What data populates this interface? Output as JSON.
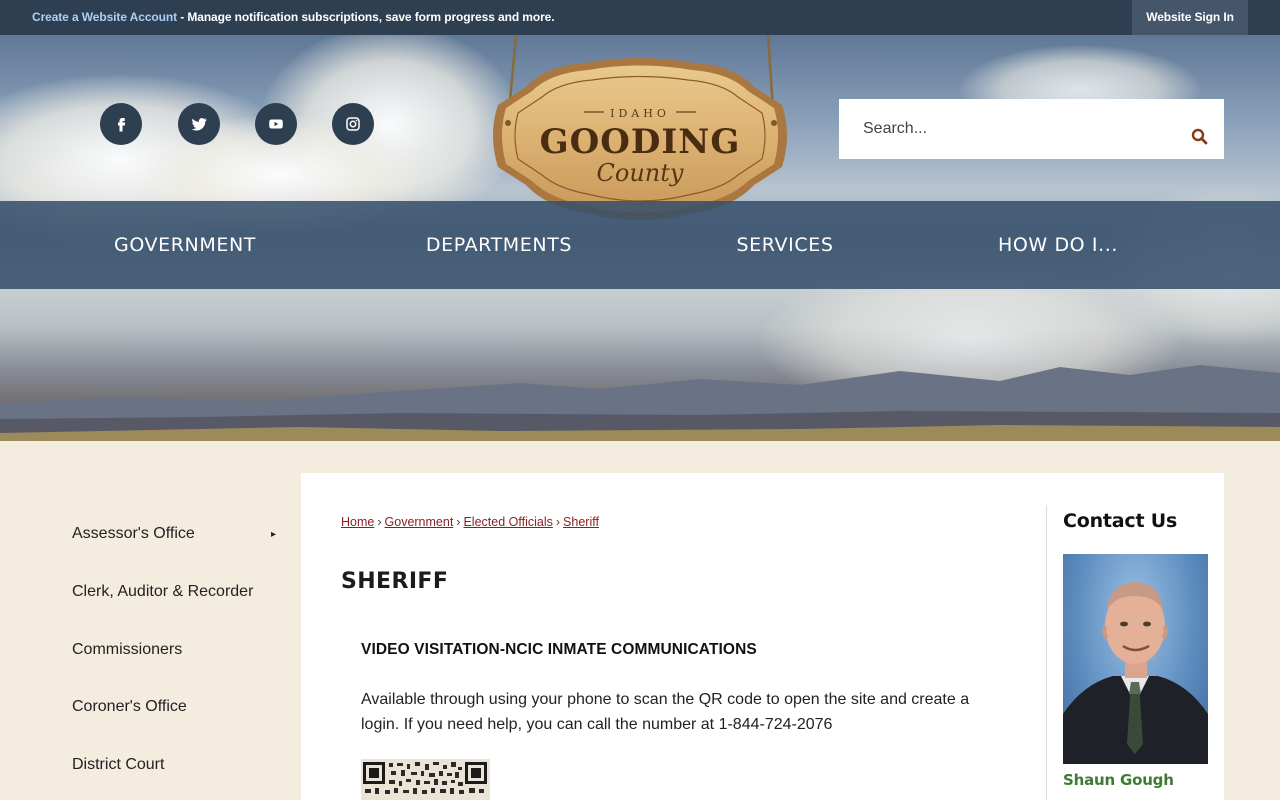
{
  "topbar": {
    "create_account_link": "Create a Website Account",
    "create_account_desc": " - Manage notification subscriptions, save form progress and more.",
    "sign_in": "Website Sign In"
  },
  "social": [
    {
      "icon": "facebook-icon"
    },
    {
      "icon": "twitter-icon"
    },
    {
      "icon": "youtube-icon"
    },
    {
      "icon": "instagram-icon"
    }
  ],
  "logo": {
    "state": "IDAHO",
    "name": "GOODING",
    "county": "County"
  },
  "search": {
    "placeholder": "Search...",
    "icon": "search-icon"
  },
  "nav": {
    "items": [
      "GOVERNMENT",
      "DEPARTMENTS",
      "SERVICES",
      "HOW DO I..."
    ]
  },
  "sidebar": {
    "items": [
      {
        "label": "Assessor's Office",
        "has_submenu": true
      },
      {
        "label": "Clerk, Auditor & Recorder"
      },
      {
        "label": "Commissioners"
      },
      {
        "label": "Coroner's Office"
      },
      {
        "label": "District Court"
      }
    ],
    "arrow": "▸"
  },
  "breadcrumb": {
    "items": [
      "Home",
      "Government",
      "Elected Officials",
      "Sheriff"
    ],
    "separator": "›"
  },
  "page": {
    "title": "SHERIFF",
    "subheading": "VIDEO VISITATION-NCIC INMATE COMMUNICATIONS",
    "body": "Available through using your phone to scan the QR code to open the site and create a login.  If you need help, you can call the number at 1-844-724-2076"
  },
  "contact": {
    "title": "Contact Us",
    "name": "Shaun Gough"
  },
  "colors": {
    "topbar": "#2f3f52",
    "nav": "#354e6a",
    "page_bg": "#f5ece0",
    "breadcrumb_link": "#8a1f1f",
    "contact_name": "#3e7a32"
  }
}
